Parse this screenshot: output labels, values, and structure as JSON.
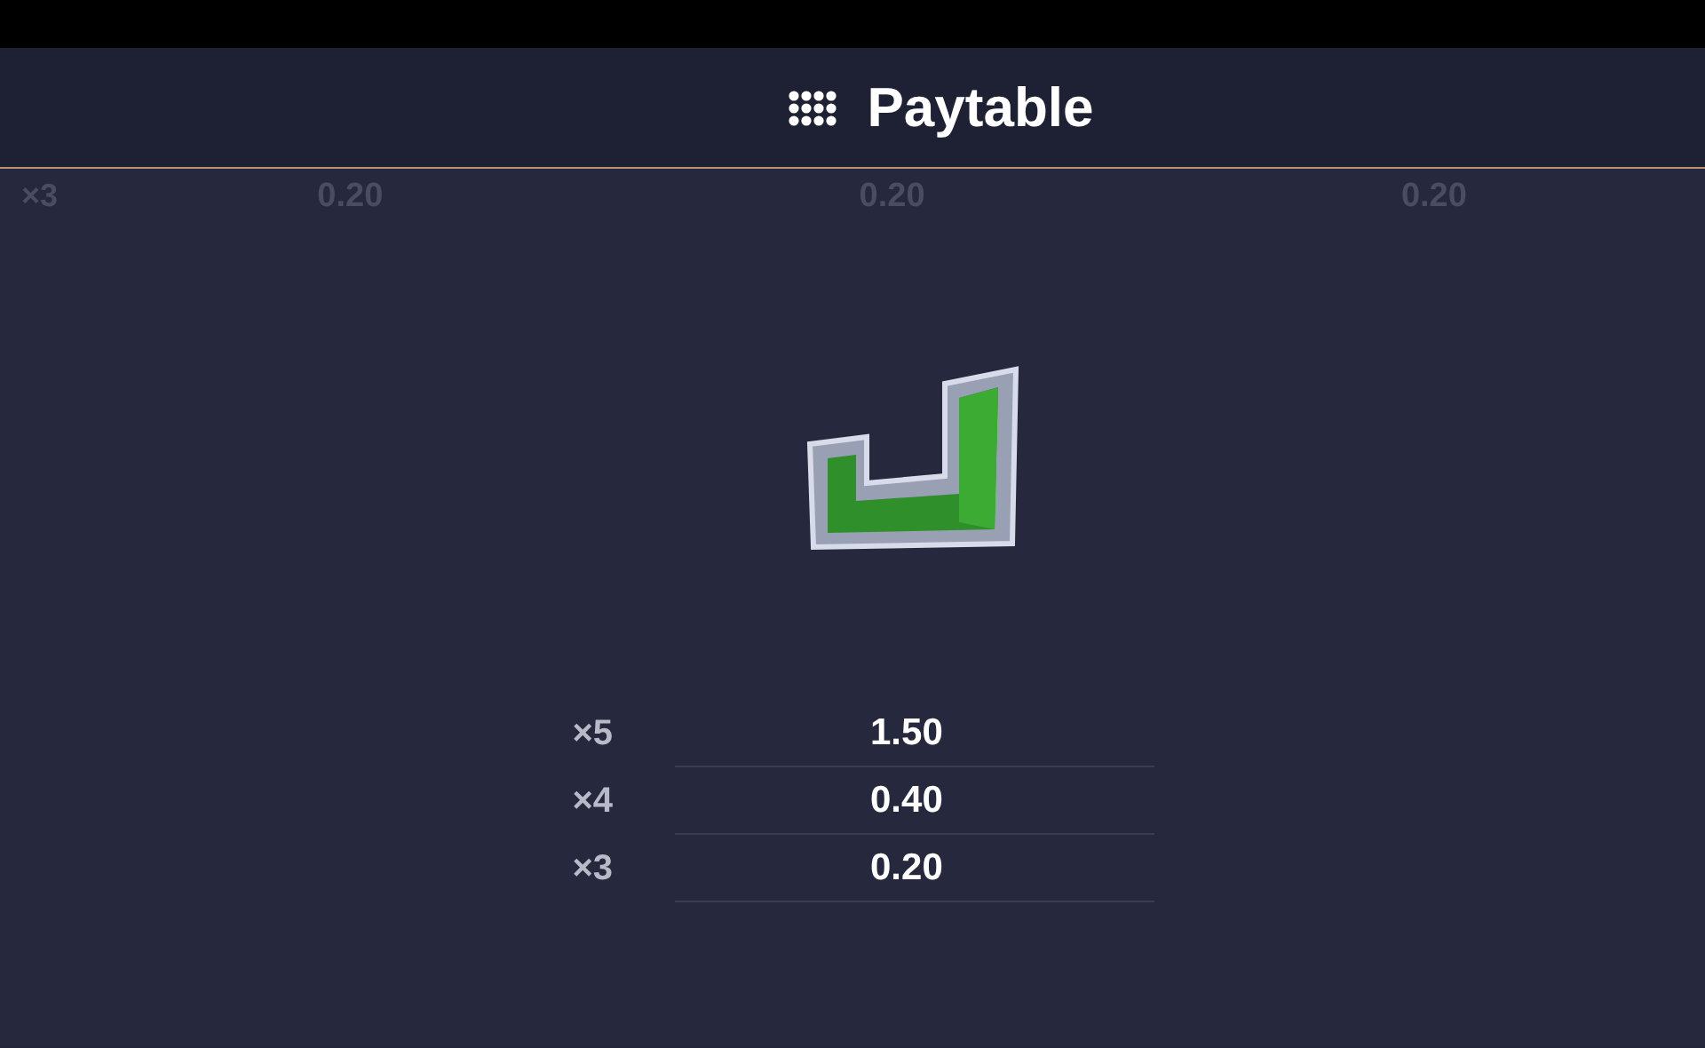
{
  "header": {
    "title": "Paytable"
  },
  "background_row": {
    "multiplier": "×3",
    "values": [
      "0.20",
      "0.20",
      "0.20"
    ]
  },
  "payouts": [
    {
      "count": "×5",
      "value": "1.50"
    },
    {
      "count": "×4",
      "value": "0.40"
    },
    {
      "count": "×3",
      "value": "0.20"
    }
  ]
}
